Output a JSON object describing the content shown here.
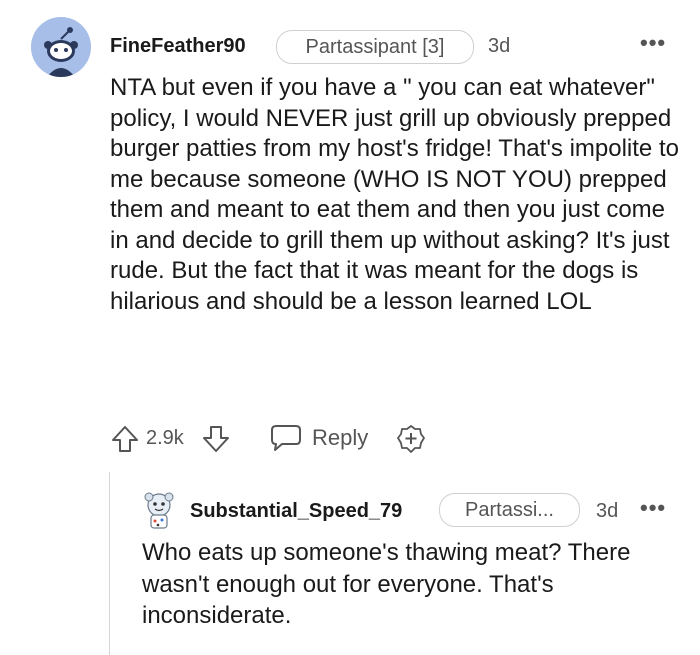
{
  "top_comment": {
    "username": "FineFeather90",
    "flair": "Partassipant [3]",
    "time": "3d",
    "more": "•••",
    "body": "NTA but even if you have a \" you can eat whatever\" policy, I would NEVER just grill up obviously prepped burger patties from my host's fridge! That's impolite to me because someone (WHO IS NOT YOU) prepped them and meant to eat them and then you just come in and decide to grill them up without asking? It's just rude. But the fact that it was meant for the dogs is hilarious and should be a lesson learned LOL",
    "score": "2.9k",
    "reply_label": "Reply",
    "avatar_color": "#a7bfe8"
  },
  "reply_comment": {
    "username": "Substantial_Speed_79",
    "flair": "Partassi...",
    "time": "3d",
    "more": "•••",
    "body": "Who eats up someone's thawing meat? There wasn't enough out for everyone. That's inconsiderate."
  },
  "icons": {
    "upvote": "arrow-up-outline-icon",
    "downvote": "arrow-down-outline-icon",
    "reply": "speech-bubble-icon",
    "award": "award-plus-icon"
  },
  "colors": {
    "text": "#1a1a1b",
    "muted": "#555555",
    "thread_line": "#d6d6d6"
  }
}
